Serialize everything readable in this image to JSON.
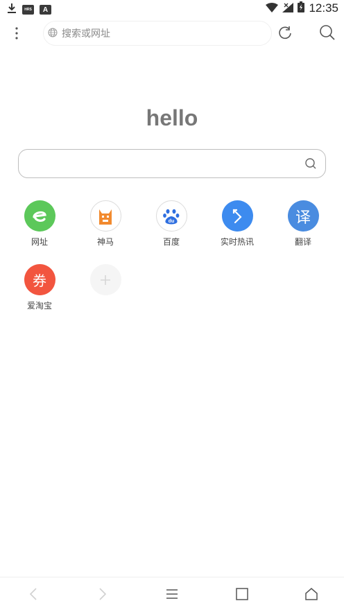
{
  "status_bar": {
    "time": "12:35",
    "left_icons": [
      "download-icon",
      "hd-icon",
      "a-icon"
    ],
    "right_icons": [
      "wifi-icon",
      "signal-icon",
      "battery-icon"
    ],
    "hd_text": "HRS",
    "a_text": "A"
  },
  "toolbar": {
    "address_placeholder": "搜索或网址"
  },
  "hello": "hello",
  "shortcuts": [
    {
      "label": "网址",
      "color": "#5cc85a",
      "glyph": "e"
    },
    {
      "label": "神马",
      "color": "#ffffff",
      "glyph": "神马"
    },
    {
      "label": "百度",
      "color": "#ffffff",
      "glyph": "du"
    },
    {
      "label": "实时热讯",
      "color": "#3d8bef",
      "glyph": "↰"
    },
    {
      "label": "翻译",
      "color": "#4a8ce0",
      "glyph": "译"
    },
    {
      "label": "爱淘宝",
      "color": "#f2553f",
      "glyph": "券"
    },
    {
      "label": "",
      "color": "#f5f5f5",
      "glyph": "+"
    }
  ],
  "colors": {
    "accent_green": "#5cc85a",
    "accent_blue": "#3d8bef",
    "accent_red": "#f2553f"
  }
}
